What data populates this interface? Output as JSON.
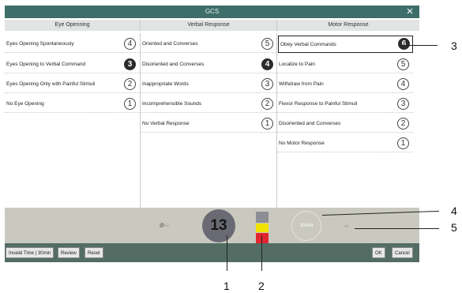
{
  "title": "GCS",
  "close_icon": "×",
  "columns": [
    {
      "header": "Eye Openning",
      "rows": [
        {
          "label": "Eyes Opening Spontaneously",
          "score": "4"
        },
        {
          "label": "Eyes Opening to Verbal Command",
          "score": "3"
        },
        {
          "label": "Eyes Opening Only with Painful Stimuli",
          "score": "2"
        },
        {
          "label": "No Eye Opening",
          "score": "1"
        }
      ]
    },
    {
      "header": "Verbal Response",
      "rows": [
        {
          "label": "Oriented and Converses",
          "score": "5"
        },
        {
          "label": "Disoriented and Converses",
          "score": "4"
        },
        {
          "label": "Inappropriate Words",
          "score": "3"
        },
        {
          "label": "Incomprehensible Sounds",
          "score": "2"
        },
        {
          "label": "No Verbal Response",
          "score": "1"
        }
      ]
    },
    {
      "header": "Motor Response",
      "rows": [
        {
          "label": "Obey Verbal Commands",
          "score": "6"
        },
        {
          "label": "Localize to Pain",
          "score": "5"
        },
        {
          "label": "Withdraw from Pain",
          "score": "4"
        },
        {
          "label": "Flexor Response to Painful Stimuli",
          "score": "3"
        },
        {
          "label": "Disoriented and Converses",
          "score": "2"
        },
        {
          "label": "No Motor Response",
          "score": ""
        }
      ]
    }
  ],
  "motor_last_score": "1",
  "status": {
    "left_text": "@-:-",
    "total": "13",
    "timer": "30min",
    "time_text": "-:-",
    "severity_colors": [
      "#8d8d95",
      "#f1e200",
      "#e2262d"
    ]
  },
  "buttons": {
    "invalid_time": "Invalid Time | 30min",
    "review": "Review",
    "reset": "Reset",
    "ok": "OK",
    "cancel": "Cancel"
  },
  "callouts": [
    "1",
    "2",
    "3",
    "4",
    "5"
  ]
}
